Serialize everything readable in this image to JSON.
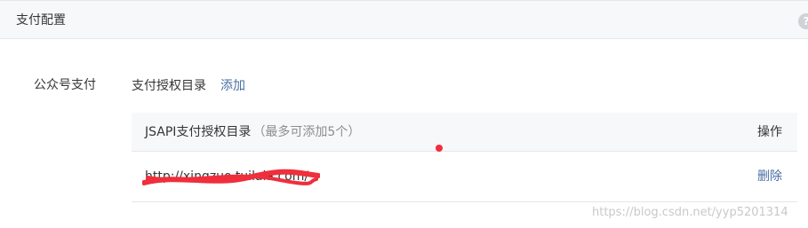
{
  "header": {
    "title": "支付配置",
    "help_glyph": "?"
  },
  "section": {
    "label": "公众号支付",
    "sub_label": "支付授权目录",
    "add_link": "添加"
  },
  "table": {
    "header": {
      "title": "JSAPI支付授权目录",
      "note": "（最多可添加5个）",
      "op": "操作"
    },
    "rows": [
      {
        "url": "http://xingzuo.tuilala.com/",
        "op": "删除"
      }
    ]
  },
  "watermark": "https://blog.csdn.net/yyp5201314",
  "colors": {
    "link": "#4a6fa5",
    "redaction": "#f02e3c",
    "header_bg": "#f7f8fa"
  },
  "icons": {
    "help": "help-icon"
  }
}
